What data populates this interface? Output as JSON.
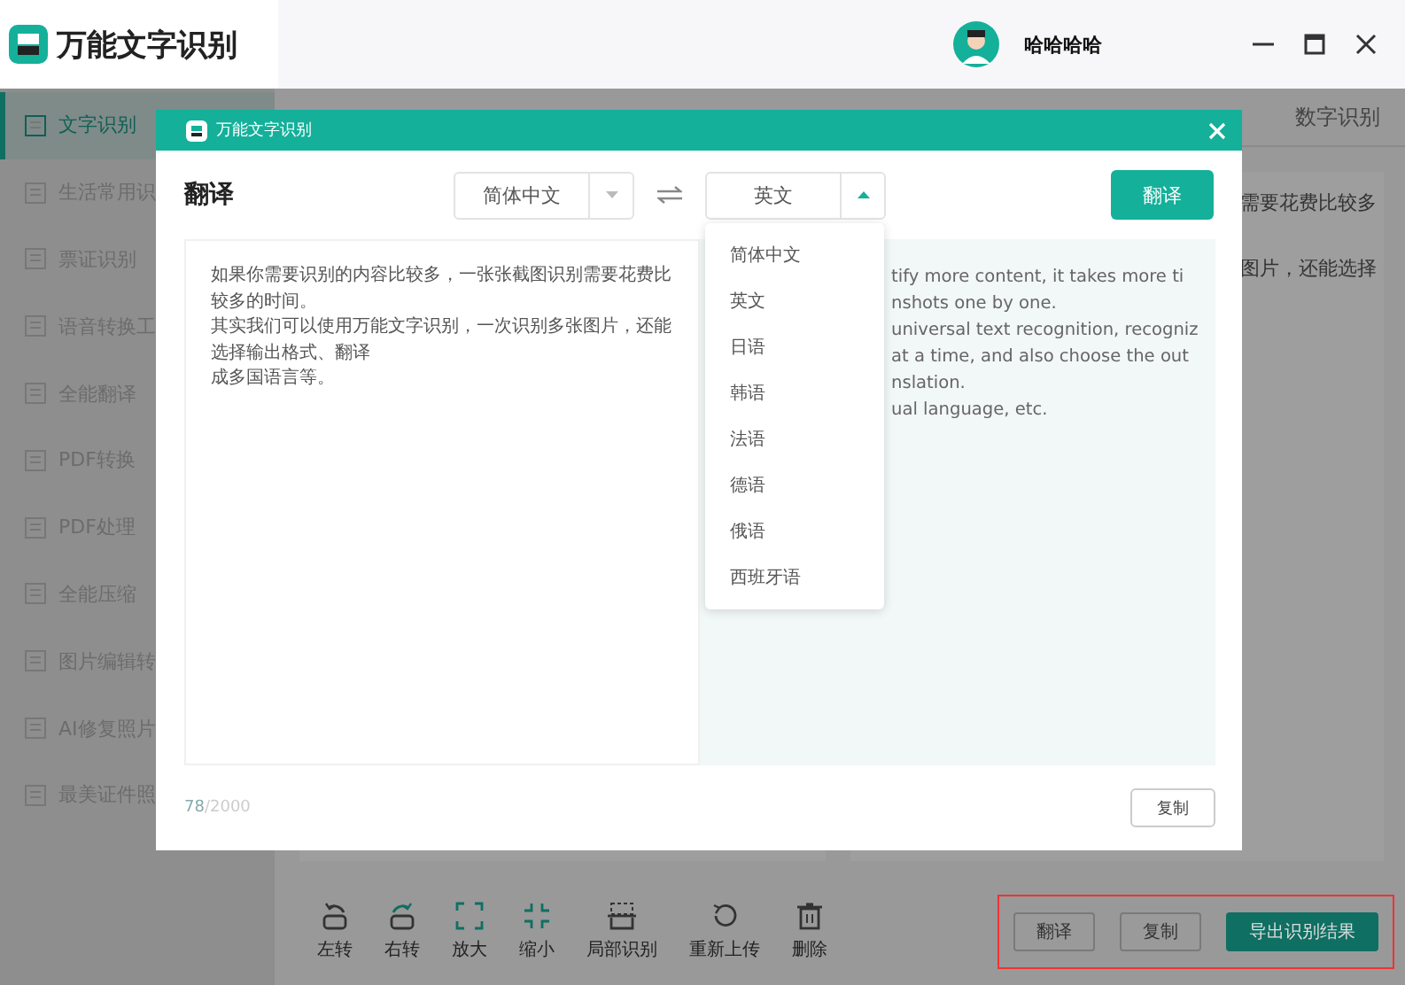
{
  "app": {
    "title": "万能文字识别",
    "user_name": "哈哈哈哈"
  },
  "sidebar": {
    "items": [
      {
        "label": "文字识别",
        "selected": true
      },
      {
        "label": "生活常用识",
        "selected": false
      },
      {
        "label": "票证识别",
        "selected": false
      },
      {
        "label": "语音转换工",
        "selected": false
      },
      {
        "label": "全能翻译",
        "selected": false
      },
      {
        "label": "PDF转换",
        "selected": false
      },
      {
        "label": "PDF处理",
        "selected": false
      },
      {
        "label": "全能压缩",
        "selected": false
      },
      {
        "label": "图片编辑转",
        "selected": false
      },
      {
        "label": "AI修复照片",
        "selected": false
      },
      {
        "label": "最美证件照",
        "selected": false
      }
    ]
  },
  "tabs": [
    {
      "label": "数字识别",
      "selected": false
    }
  ],
  "result_text": [
    "需要花费比较多",
    "图片，还能选择"
  ],
  "toolbar": [
    {
      "kind": "left",
      "label": "左转"
    },
    {
      "kind": "right",
      "label": "右转"
    },
    {
      "kind": "enlarge",
      "label": "放大"
    },
    {
      "kind": "shrink",
      "label": "缩小"
    },
    {
      "kind": "region",
      "label": "局部识别"
    },
    {
      "kind": "reupload",
      "label": "重新上传"
    },
    {
      "kind": "delete",
      "label": "删除"
    }
  ],
  "action_buttons": [
    {
      "label": "翻译",
      "primary": false
    },
    {
      "label": "复制",
      "primary": false
    },
    {
      "label": "导出识别结果",
      "primary": true
    }
  ],
  "dialog": {
    "title": "万能文字识别",
    "heading": "翻译",
    "source_language": "简体中文",
    "target_language": "英文",
    "translate_button": "翻译",
    "dropdown": {
      "expanded": true,
      "options": [
        {
          "label": "简体中文",
          "selected": false
        },
        {
          "label": "英文",
          "selected": false
        },
        {
          "label": "日语",
          "selected": false
        },
        {
          "label": "韩语",
          "selected": false
        },
        {
          "label": "法语",
          "selected": false
        },
        {
          "label": "德语",
          "selected": false
        },
        {
          "label": "俄语",
          "selected": false
        },
        {
          "label": "西班牙语",
          "selected": false
        }
      ]
    },
    "source_text": [
      "如果你需要识别的内容比较多，一张张截图识别需要花费比较多的时间。",
      "其实我们可以使用万能文字识别，一次识别多张图片，还能选择输出格式、翻译",
      "成多国语言等。"
    ],
    "output_text": [
      "tify more content, it takes more ti",
      "nshots one by one.",
      "universal text recognition, recogniz",
      "at a time, and also choose the out",
      "nslation.",
      "ual language, etc."
    ],
    "char_count": "78",
    "char_limit": "/2000",
    "copy_button": "复制"
  }
}
